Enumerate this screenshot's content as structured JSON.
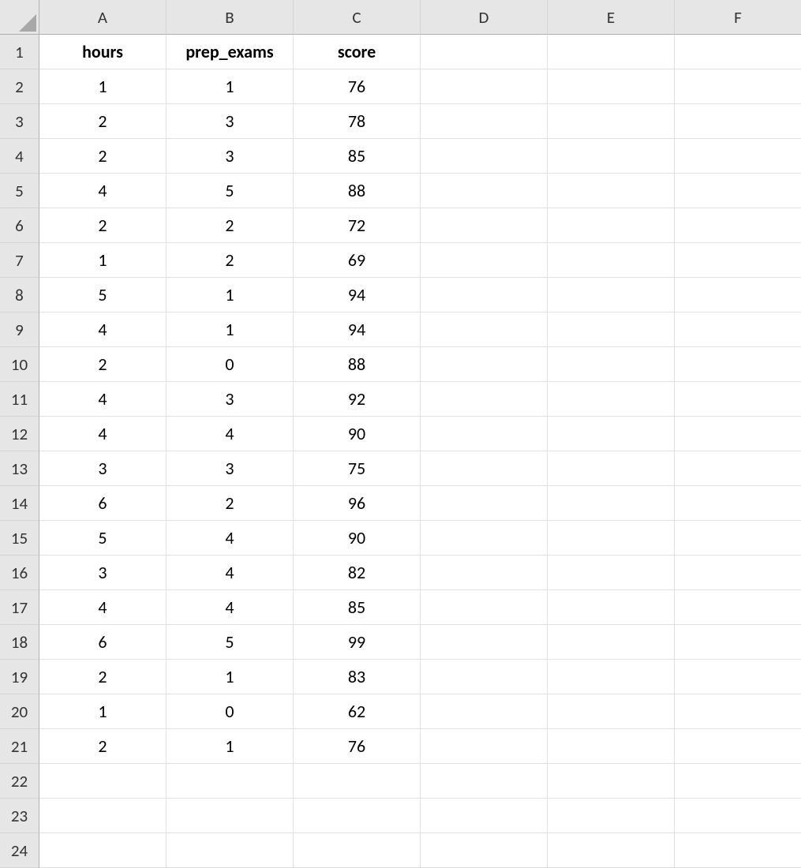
{
  "columns": [
    "A",
    "B",
    "C",
    "D",
    "E",
    "F"
  ],
  "row_numbers": [
    1,
    2,
    3,
    4,
    5,
    6,
    7,
    8,
    9,
    10,
    11,
    12,
    13,
    14,
    15,
    16,
    17,
    18,
    19,
    20,
    21,
    22,
    23,
    24
  ],
  "headers": {
    "A": "hours",
    "B": "prep_exams",
    "C": "score"
  },
  "data_rows": [
    {
      "hours": 1,
      "prep_exams": 1,
      "score": 76
    },
    {
      "hours": 2,
      "prep_exams": 3,
      "score": 78
    },
    {
      "hours": 2,
      "prep_exams": 3,
      "score": 85
    },
    {
      "hours": 4,
      "prep_exams": 5,
      "score": 88
    },
    {
      "hours": 2,
      "prep_exams": 2,
      "score": 72
    },
    {
      "hours": 1,
      "prep_exams": 2,
      "score": 69
    },
    {
      "hours": 5,
      "prep_exams": 1,
      "score": 94
    },
    {
      "hours": 4,
      "prep_exams": 1,
      "score": 94
    },
    {
      "hours": 2,
      "prep_exams": 0,
      "score": 88
    },
    {
      "hours": 4,
      "prep_exams": 3,
      "score": 92
    },
    {
      "hours": 4,
      "prep_exams": 4,
      "score": 90
    },
    {
      "hours": 3,
      "prep_exams": 3,
      "score": 75
    },
    {
      "hours": 6,
      "prep_exams": 2,
      "score": 96
    },
    {
      "hours": 5,
      "prep_exams": 4,
      "score": 90
    },
    {
      "hours": 3,
      "prep_exams": 4,
      "score": 82
    },
    {
      "hours": 4,
      "prep_exams": 4,
      "score": 85
    },
    {
      "hours": 6,
      "prep_exams": 5,
      "score": 99
    },
    {
      "hours": 2,
      "prep_exams": 1,
      "score": 83
    },
    {
      "hours": 1,
      "prep_exams": 0,
      "score": 62
    },
    {
      "hours": 2,
      "prep_exams": 1,
      "score": 76
    }
  ]
}
